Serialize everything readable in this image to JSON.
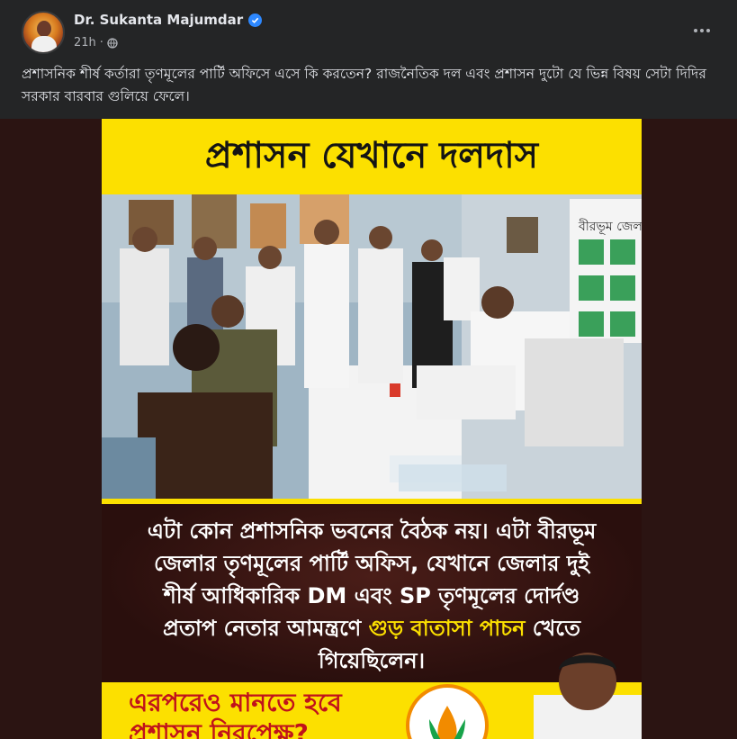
{
  "post": {
    "author": "Dr. Sukanta Majumdar",
    "time": "21h",
    "caption": "প্রশাসনিক শীর্ষ কর্তারা তৃণমূলের পার্টি অফিসে এসে কি করতেন? রাজনৈতিক দল এবং প্রশাসন দুটো যে ভিন্ন বিষয় সেটা দিদির সরকার বারবার গুলিয়ে ফেলে।"
  },
  "poster": {
    "headline": "প্রশাসন যেখানে দলদাস",
    "body_part1": "এটা কোন প্রশাসনিক ভবনের বৈঠক নয়। এটা বীরভূম জেলার তৃণমূলের পার্টি অফিস, যেখানে জেলার দুই শীর্ষ আধিকারিক DM এবং SP তৃণমূলের দোর্দণ্ড প্রতাপ নেতার আমন্ত্রণে",
    "body_highlight": "গুড় বাতাসা পাচন",
    "body_part2": "খেতে গিয়েছিলেন।",
    "footer": "এরপরেও মানতে হবে প্রশাসন নিরপেক্ষ?",
    "wall_sign": "বীরভূম জেলা"
  },
  "icons": {
    "verified": "verified-badge-icon",
    "privacy": "globe-icon",
    "more": "more-horizontal-icon"
  },
  "colors": {
    "background": "#18191a",
    "card": "#242526",
    "verified": "#2d88ff",
    "poster_yellow": "#fce000",
    "poster_red": "#c0121b"
  }
}
